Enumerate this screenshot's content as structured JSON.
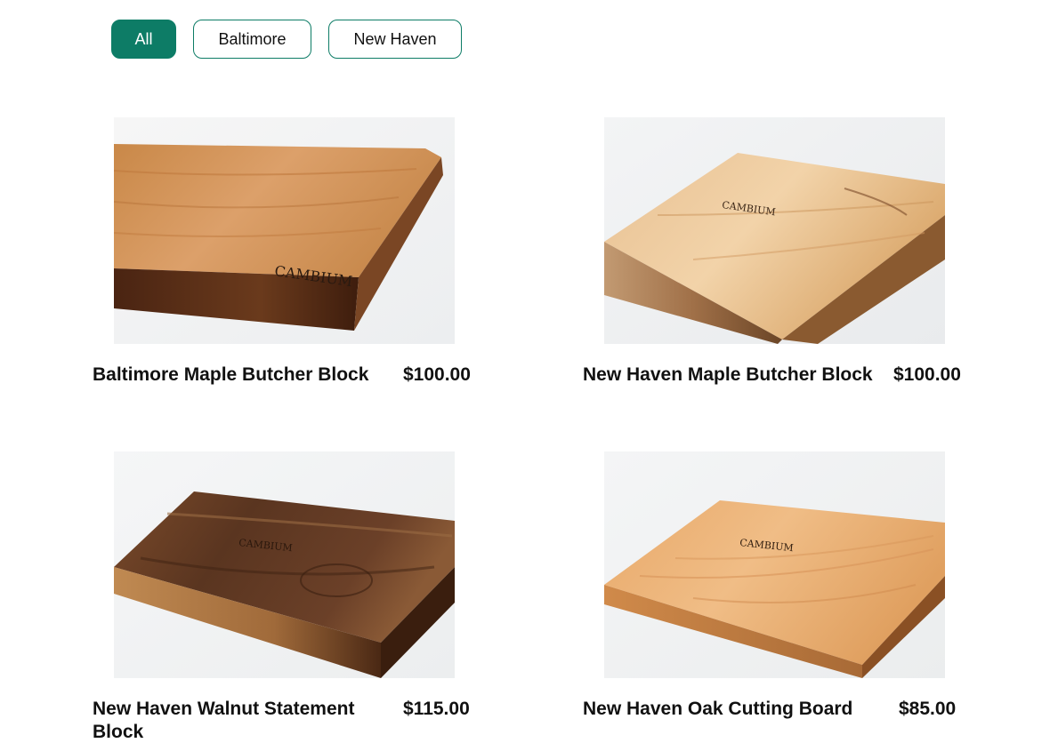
{
  "filters": [
    {
      "label": "All",
      "active": true
    },
    {
      "label": "Baltimore",
      "active": false
    },
    {
      "label": "New Haven",
      "active": false
    }
  ],
  "products": [
    {
      "name": "Baltimore Maple Butcher Block",
      "price": "$100.00",
      "wood": "maple",
      "brand_mark": "CAMBIUM"
    },
    {
      "name": "New Haven Maple Butcher Block",
      "price": "$100.00",
      "wood": "maple-light",
      "brand_mark": "CAMBIUM"
    },
    {
      "name": "New Haven Walnut Statement Block",
      "price": "$115.00",
      "wood": "walnut",
      "brand_mark": "CAMBIUM"
    },
    {
      "name": "New Haven Oak Cutting Board",
      "price": "$85.00",
      "wood": "oak",
      "brand_mark": "CAMBIUM"
    }
  ],
  "colors": {
    "accent": "#0d7c66",
    "text": "#111111",
    "background": "#ffffff"
  }
}
